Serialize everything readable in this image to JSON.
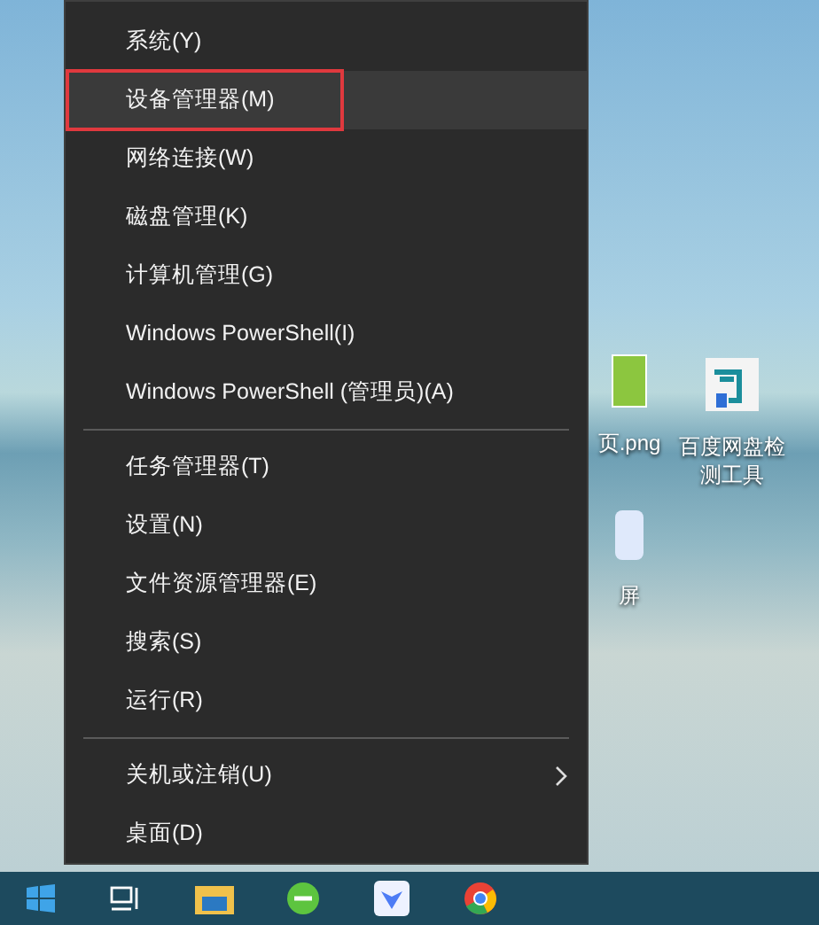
{
  "context_menu": {
    "groups": [
      [
        {
          "label": "系统(Y)",
          "kind": "item",
          "highlighted": false
        },
        {
          "label": "设备管理器(M)",
          "kind": "item",
          "highlighted": true
        },
        {
          "label": "网络连接(W)",
          "kind": "item",
          "highlighted": false
        },
        {
          "label": "磁盘管理(K)",
          "kind": "item",
          "highlighted": false
        },
        {
          "label": "计算机管理(G)",
          "kind": "item",
          "highlighted": false
        },
        {
          "label": "Windows PowerShell(I)",
          "kind": "item",
          "highlighted": false
        },
        {
          "label": "Windows PowerShell (管理员)(A)",
          "kind": "item",
          "highlighted": false
        }
      ],
      [
        {
          "label": "任务管理器(T)",
          "kind": "item",
          "highlighted": false
        },
        {
          "label": "设置(N)",
          "kind": "item",
          "highlighted": false
        },
        {
          "label": "文件资源管理器(E)",
          "kind": "item",
          "highlighted": false
        },
        {
          "label": "搜索(S)",
          "kind": "item",
          "highlighted": false
        },
        {
          "label": "运行(R)",
          "kind": "item",
          "highlighted": false
        }
      ],
      [
        {
          "label": "关机或注销(U)",
          "kind": "submenu",
          "highlighted": false
        },
        {
          "label": "桌面(D)",
          "kind": "item",
          "highlighted": false
        }
      ]
    ]
  },
  "desktop_icons": [
    {
      "kind": "image",
      "label_lines": [
        "页.png"
      ]
    },
    {
      "kind": "app",
      "label_lines": [
        "百度网盘检",
        "测工具"
      ]
    },
    {
      "kind": "file",
      "label_lines": [
        "屏"
      ]
    }
  ],
  "taskbar": {
    "apps": [
      {
        "kind": "task-view"
      },
      {
        "kind": "explorer"
      },
      {
        "kind": "green"
      },
      {
        "kind": "blue"
      },
      {
        "kind": "chrome"
      }
    ]
  }
}
